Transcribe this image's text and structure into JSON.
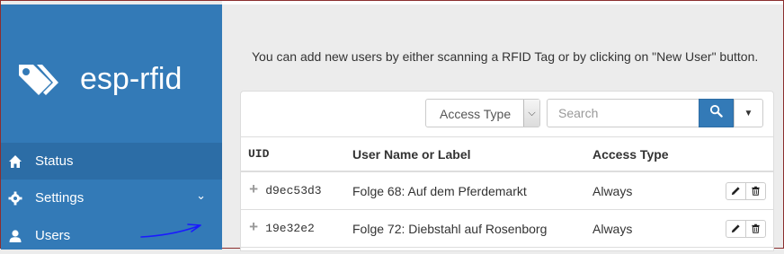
{
  "app": {
    "title": "esp-rfid"
  },
  "sidebar": {
    "items": [
      {
        "label": "Status",
        "icon": "home-icon",
        "active": true
      },
      {
        "label": "Settings",
        "icon": "gear-icon",
        "has_submenu": true
      },
      {
        "label": "Users",
        "icon": "user-icon"
      }
    ]
  },
  "main": {
    "intro": "You can add new users by either scanning a RFID Tag or by clicking on \"New User\" button."
  },
  "toolbar": {
    "filter_value": "Access Type",
    "search_placeholder": "Search"
  },
  "table": {
    "headers": [
      "UID",
      "User Name or Label",
      "Access Type"
    ],
    "rows": [
      {
        "uid": "d9ec53d3",
        "label": "Folge 68: Auf dem Pferdemarkt",
        "access": "Always"
      },
      {
        "uid": "19e32e2",
        "label": "Folge 72: Diebstahl auf Rosenborg",
        "access": "Always"
      }
    ]
  },
  "colors": {
    "accent": "#337ab7",
    "sidebar_active": "#2c6da6",
    "annotation": "#1a1aff"
  }
}
